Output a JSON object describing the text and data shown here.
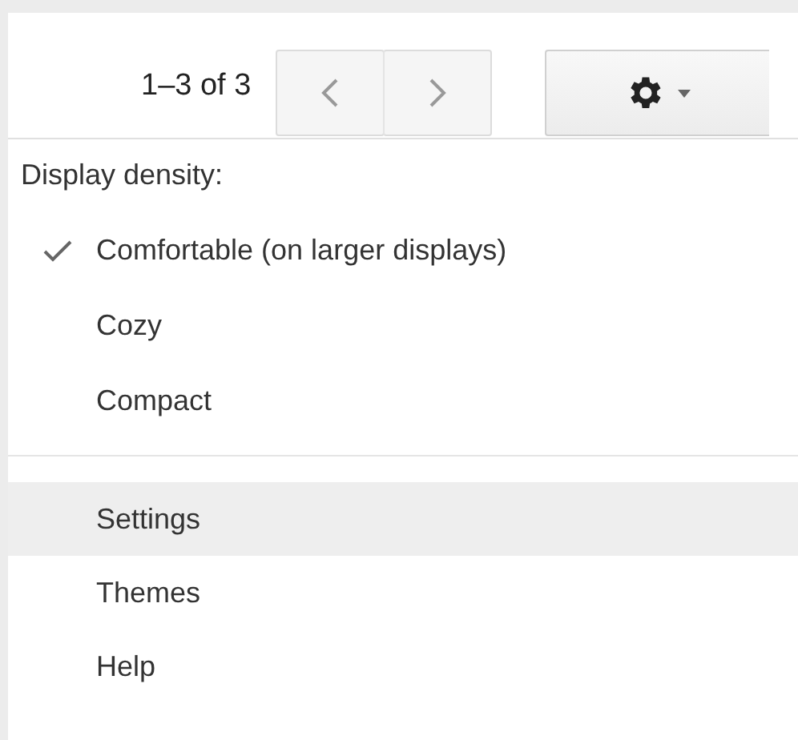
{
  "pager": {
    "count": "1–3 of 3"
  },
  "density_menu": {
    "heading": "Display density:",
    "options": [
      {
        "label": "Comfortable (on larger displays)",
        "checked": true
      },
      {
        "label": "Cozy",
        "checked": false
      },
      {
        "label": "Compact",
        "checked": false
      }
    ]
  },
  "menu_items": [
    {
      "label": "Settings",
      "selected": true
    },
    {
      "label": "Themes",
      "selected": false
    },
    {
      "label": "Help",
      "selected": false
    }
  ]
}
